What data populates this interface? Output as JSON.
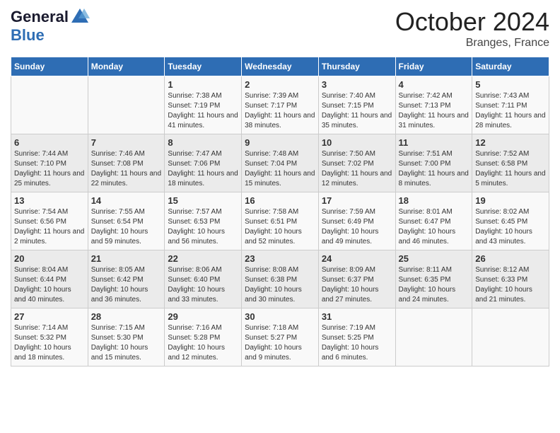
{
  "header": {
    "logo_line1": "General",
    "logo_line2": "Blue",
    "month_title": "October 2024",
    "location": "Branges, France"
  },
  "weekdays": [
    "Sunday",
    "Monday",
    "Tuesday",
    "Wednesday",
    "Thursday",
    "Friday",
    "Saturday"
  ],
  "weeks": [
    [
      {
        "day": "",
        "sunrise": "",
        "sunset": "",
        "daylight": ""
      },
      {
        "day": "",
        "sunrise": "",
        "sunset": "",
        "daylight": ""
      },
      {
        "day": "1",
        "sunrise": "Sunrise: 7:38 AM",
        "sunset": "Sunset: 7:19 PM",
        "daylight": "Daylight: 11 hours and 41 minutes."
      },
      {
        "day": "2",
        "sunrise": "Sunrise: 7:39 AM",
        "sunset": "Sunset: 7:17 PM",
        "daylight": "Daylight: 11 hours and 38 minutes."
      },
      {
        "day": "3",
        "sunrise": "Sunrise: 7:40 AM",
        "sunset": "Sunset: 7:15 PM",
        "daylight": "Daylight: 11 hours and 35 minutes."
      },
      {
        "day": "4",
        "sunrise": "Sunrise: 7:42 AM",
        "sunset": "Sunset: 7:13 PM",
        "daylight": "Daylight: 11 hours and 31 minutes."
      },
      {
        "day": "5",
        "sunrise": "Sunrise: 7:43 AM",
        "sunset": "Sunset: 7:11 PM",
        "daylight": "Daylight: 11 hours and 28 minutes."
      }
    ],
    [
      {
        "day": "6",
        "sunrise": "Sunrise: 7:44 AM",
        "sunset": "Sunset: 7:10 PM",
        "daylight": "Daylight: 11 hours and 25 minutes."
      },
      {
        "day": "7",
        "sunrise": "Sunrise: 7:46 AM",
        "sunset": "Sunset: 7:08 PM",
        "daylight": "Daylight: 11 hours and 22 minutes."
      },
      {
        "day": "8",
        "sunrise": "Sunrise: 7:47 AM",
        "sunset": "Sunset: 7:06 PM",
        "daylight": "Daylight: 11 hours and 18 minutes."
      },
      {
        "day": "9",
        "sunrise": "Sunrise: 7:48 AM",
        "sunset": "Sunset: 7:04 PM",
        "daylight": "Daylight: 11 hours and 15 minutes."
      },
      {
        "day": "10",
        "sunrise": "Sunrise: 7:50 AM",
        "sunset": "Sunset: 7:02 PM",
        "daylight": "Daylight: 11 hours and 12 minutes."
      },
      {
        "day": "11",
        "sunrise": "Sunrise: 7:51 AM",
        "sunset": "Sunset: 7:00 PM",
        "daylight": "Daylight: 11 hours and 8 minutes."
      },
      {
        "day": "12",
        "sunrise": "Sunrise: 7:52 AM",
        "sunset": "Sunset: 6:58 PM",
        "daylight": "Daylight: 11 hours and 5 minutes."
      }
    ],
    [
      {
        "day": "13",
        "sunrise": "Sunrise: 7:54 AM",
        "sunset": "Sunset: 6:56 PM",
        "daylight": "Daylight: 11 hours and 2 minutes."
      },
      {
        "day": "14",
        "sunrise": "Sunrise: 7:55 AM",
        "sunset": "Sunset: 6:54 PM",
        "daylight": "Daylight: 10 hours and 59 minutes."
      },
      {
        "day": "15",
        "sunrise": "Sunrise: 7:57 AM",
        "sunset": "Sunset: 6:53 PM",
        "daylight": "Daylight: 10 hours and 56 minutes."
      },
      {
        "day": "16",
        "sunrise": "Sunrise: 7:58 AM",
        "sunset": "Sunset: 6:51 PM",
        "daylight": "Daylight: 10 hours and 52 minutes."
      },
      {
        "day": "17",
        "sunrise": "Sunrise: 7:59 AM",
        "sunset": "Sunset: 6:49 PM",
        "daylight": "Daylight: 10 hours and 49 minutes."
      },
      {
        "day": "18",
        "sunrise": "Sunrise: 8:01 AM",
        "sunset": "Sunset: 6:47 PM",
        "daylight": "Daylight: 10 hours and 46 minutes."
      },
      {
        "day": "19",
        "sunrise": "Sunrise: 8:02 AM",
        "sunset": "Sunset: 6:45 PM",
        "daylight": "Daylight: 10 hours and 43 minutes."
      }
    ],
    [
      {
        "day": "20",
        "sunrise": "Sunrise: 8:04 AM",
        "sunset": "Sunset: 6:44 PM",
        "daylight": "Daylight: 10 hours and 40 minutes."
      },
      {
        "day": "21",
        "sunrise": "Sunrise: 8:05 AM",
        "sunset": "Sunset: 6:42 PM",
        "daylight": "Daylight: 10 hours and 36 minutes."
      },
      {
        "day": "22",
        "sunrise": "Sunrise: 8:06 AM",
        "sunset": "Sunset: 6:40 PM",
        "daylight": "Daylight: 10 hours and 33 minutes."
      },
      {
        "day": "23",
        "sunrise": "Sunrise: 8:08 AM",
        "sunset": "Sunset: 6:38 PM",
        "daylight": "Daylight: 10 hours and 30 minutes."
      },
      {
        "day": "24",
        "sunrise": "Sunrise: 8:09 AM",
        "sunset": "Sunset: 6:37 PM",
        "daylight": "Daylight: 10 hours and 27 minutes."
      },
      {
        "day": "25",
        "sunrise": "Sunrise: 8:11 AM",
        "sunset": "Sunset: 6:35 PM",
        "daylight": "Daylight: 10 hours and 24 minutes."
      },
      {
        "day": "26",
        "sunrise": "Sunrise: 8:12 AM",
        "sunset": "Sunset: 6:33 PM",
        "daylight": "Daylight: 10 hours and 21 minutes."
      }
    ],
    [
      {
        "day": "27",
        "sunrise": "Sunrise: 7:14 AM",
        "sunset": "Sunset: 5:32 PM",
        "daylight": "Daylight: 10 hours and 18 minutes."
      },
      {
        "day": "28",
        "sunrise": "Sunrise: 7:15 AM",
        "sunset": "Sunset: 5:30 PM",
        "daylight": "Daylight: 10 hours and 15 minutes."
      },
      {
        "day": "29",
        "sunrise": "Sunrise: 7:16 AM",
        "sunset": "Sunset: 5:28 PM",
        "daylight": "Daylight: 10 hours and 12 minutes."
      },
      {
        "day": "30",
        "sunrise": "Sunrise: 7:18 AM",
        "sunset": "Sunset: 5:27 PM",
        "daylight": "Daylight: 10 hours and 9 minutes."
      },
      {
        "day": "31",
        "sunrise": "Sunrise: 7:19 AM",
        "sunset": "Sunset: 5:25 PM",
        "daylight": "Daylight: 10 hours and 6 minutes."
      },
      {
        "day": "",
        "sunrise": "",
        "sunset": "",
        "daylight": ""
      },
      {
        "day": "",
        "sunrise": "",
        "sunset": "",
        "daylight": ""
      }
    ]
  ]
}
